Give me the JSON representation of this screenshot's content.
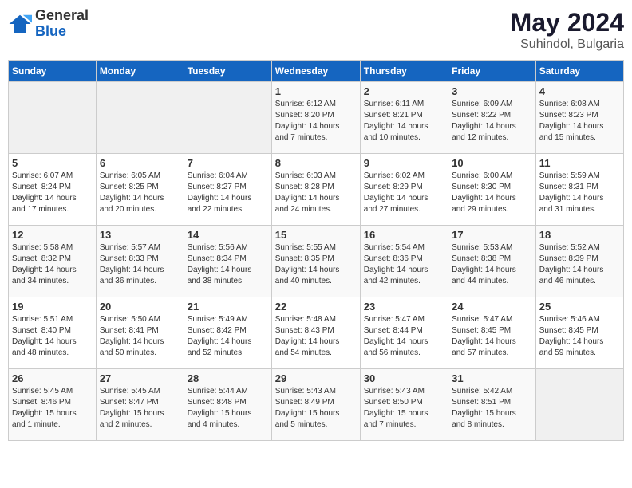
{
  "logo": {
    "general": "General",
    "blue": "Blue"
  },
  "title": {
    "month": "May 2024",
    "location": "Suhindol, Bulgaria"
  },
  "headers": [
    "Sunday",
    "Monday",
    "Tuesday",
    "Wednesday",
    "Thursday",
    "Friday",
    "Saturday"
  ],
  "weeks": [
    [
      {
        "day": "",
        "info": ""
      },
      {
        "day": "",
        "info": ""
      },
      {
        "day": "",
        "info": ""
      },
      {
        "day": "1",
        "info": "Sunrise: 6:12 AM\nSunset: 8:20 PM\nDaylight: 14 hours\nand 7 minutes."
      },
      {
        "day": "2",
        "info": "Sunrise: 6:11 AM\nSunset: 8:21 PM\nDaylight: 14 hours\nand 10 minutes."
      },
      {
        "day": "3",
        "info": "Sunrise: 6:09 AM\nSunset: 8:22 PM\nDaylight: 14 hours\nand 12 minutes."
      },
      {
        "day": "4",
        "info": "Sunrise: 6:08 AM\nSunset: 8:23 PM\nDaylight: 14 hours\nand 15 minutes."
      }
    ],
    [
      {
        "day": "5",
        "info": "Sunrise: 6:07 AM\nSunset: 8:24 PM\nDaylight: 14 hours\nand 17 minutes."
      },
      {
        "day": "6",
        "info": "Sunrise: 6:05 AM\nSunset: 8:25 PM\nDaylight: 14 hours\nand 20 minutes."
      },
      {
        "day": "7",
        "info": "Sunrise: 6:04 AM\nSunset: 8:27 PM\nDaylight: 14 hours\nand 22 minutes."
      },
      {
        "day": "8",
        "info": "Sunrise: 6:03 AM\nSunset: 8:28 PM\nDaylight: 14 hours\nand 24 minutes."
      },
      {
        "day": "9",
        "info": "Sunrise: 6:02 AM\nSunset: 8:29 PM\nDaylight: 14 hours\nand 27 minutes."
      },
      {
        "day": "10",
        "info": "Sunrise: 6:00 AM\nSunset: 8:30 PM\nDaylight: 14 hours\nand 29 minutes."
      },
      {
        "day": "11",
        "info": "Sunrise: 5:59 AM\nSunset: 8:31 PM\nDaylight: 14 hours\nand 31 minutes."
      }
    ],
    [
      {
        "day": "12",
        "info": "Sunrise: 5:58 AM\nSunset: 8:32 PM\nDaylight: 14 hours\nand 34 minutes."
      },
      {
        "day": "13",
        "info": "Sunrise: 5:57 AM\nSunset: 8:33 PM\nDaylight: 14 hours\nand 36 minutes."
      },
      {
        "day": "14",
        "info": "Sunrise: 5:56 AM\nSunset: 8:34 PM\nDaylight: 14 hours\nand 38 minutes."
      },
      {
        "day": "15",
        "info": "Sunrise: 5:55 AM\nSunset: 8:35 PM\nDaylight: 14 hours\nand 40 minutes."
      },
      {
        "day": "16",
        "info": "Sunrise: 5:54 AM\nSunset: 8:36 PM\nDaylight: 14 hours\nand 42 minutes."
      },
      {
        "day": "17",
        "info": "Sunrise: 5:53 AM\nSunset: 8:38 PM\nDaylight: 14 hours\nand 44 minutes."
      },
      {
        "day": "18",
        "info": "Sunrise: 5:52 AM\nSunset: 8:39 PM\nDaylight: 14 hours\nand 46 minutes."
      }
    ],
    [
      {
        "day": "19",
        "info": "Sunrise: 5:51 AM\nSunset: 8:40 PM\nDaylight: 14 hours\nand 48 minutes."
      },
      {
        "day": "20",
        "info": "Sunrise: 5:50 AM\nSunset: 8:41 PM\nDaylight: 14 hours\nand 50 minutes."
      },
      {
        "day": "21",
        "info": "Sunrise: 5:49 AM\nSunset: 8:42 PM\nDaylight: 14 hours\nand 52 minutes."
      },
      {
        "day": "22",
        "info": "Sunrise: 5:48 AM\nSunset: 8:43 PM\nDaylight: 14 hours\nand 54 minutes."
      },
      {
        "day": "23",
        "info": "Sunrise: 5:47 AM\nSunset: 8:44 PM\nDaylight: 14 hours\nand 56 minutes."
      },
      {
        "day": "24",
        "info": "Sunrise: 5:47 AM\nSunset: 8:45 PM\nDaylight: 14 hours\nand 57 minutes."
      },
      {
        "day": "25",
        "info": "Sunrise: 5:46 AM\nSunset: 8:45 PM\nDaylight: 14 hours\nand 59 minutes."
      }
    ],
    [
      {
        "day": "26",
        "info": "Sunrise: 5:45 AM\nSunset: 8:46 PM\nDaylight: 15 hours\nand 1 minute."
      },
      {
        "day": "27",
        "info": "Sunrise: 5:45 AM\nSunset: 8:47 PM\nDaylight: 15 hours\nand 2 minutes."
      },
      {
        "day": "28",
        "info": "Sunrise: 5:44 AM\nSunset: 8:48 PM\nDaylight: 15 hours\nand 4 minutes."
      },
      {
        "day": "29",
        "info": "Sunrise: 5:43 AM\nSunset: 8:49 PM\nDaylight: 15 hours\nand 5 minutes."
      },
      {
        "day": "30",
        "info": "Sunrise: 5:43 AM\nSunset: 8:50 PM\nDaylight: 15 hours\nand 7 minutes."
      },
      {
        "day": "31",
        "info": "Sunrise: 5:42 AM\nSunset: 8:51 PM\nDaylight: 15 hours\nand 8 minutes."
      },
      {
        "day": "",
        "info": ""
      }
    ]
  ]
}
